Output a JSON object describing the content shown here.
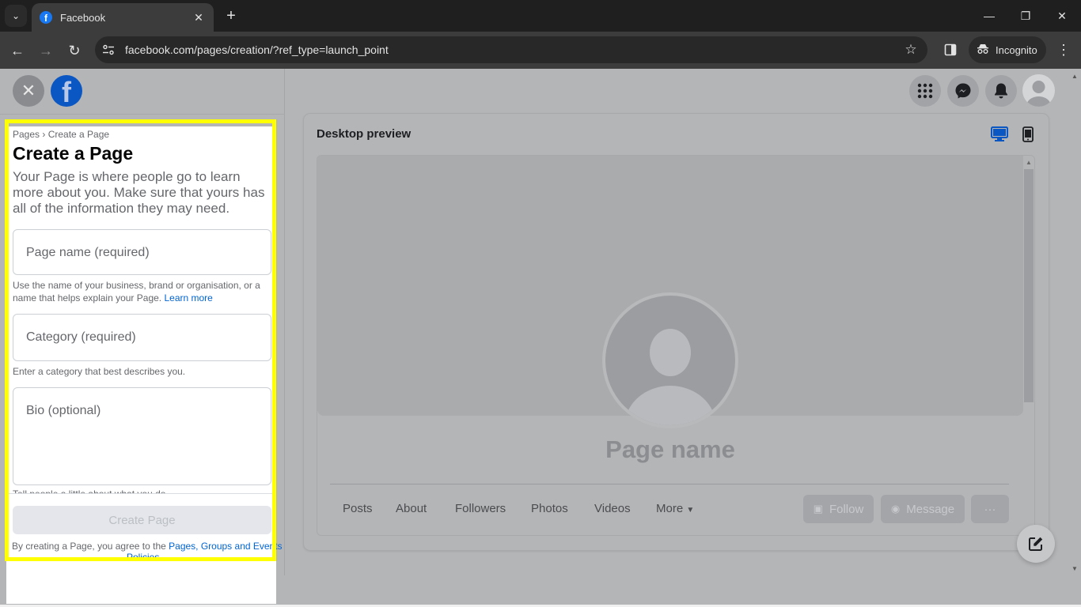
{
  "browser": {
    "tab_title": "Facebook",
    "url": "facebook.com/pages/creation/?ref_type=launch_point",
    "incognito_label": "Incognito"
  },
  "form": {
    "breadcrumb": "Pages › Create a Page",
    "title": "Create a Page",
    "intro": "Your Page is where people go to learn more about you. Make sure that yours has all of the information they may need.",
    "page_name_placeholder": "Page name (required)",
    "page_name_help": "Use the name of your business, brand or organisation, or a name that helps explain your Page.",
    "learn_more": "Learn more",
    "category_placeholder": "Category (required)",
    "category_help": "Enter a category that best describes you.",
    "bio_placeholder": "Bio (optional)",
    "bio_help": "Tell people a little about what you do.",
    "create_button": "Create Page",
    "agree_prefix": "By creating a Page, you agree to the",
    "agree_link": "Pages, Groups and Events",
    "agree_link_2": "Policies"
  },
  "preview": {
    "title": "Desktop preview",
    "page_name": "Page name",
    "tabs": [
      "Posts",
      "About",
      "Followers",
      "Photos",
      "Videos",
      "More"
    ],
    "follow": "Follow",
    "message": "Message",
    "more_dots": "···"
  },
  "colors": {
    "highlight": "#ffff00",
    "brand": "#1877f2",
    "link": "#0064d1"
  }
}
